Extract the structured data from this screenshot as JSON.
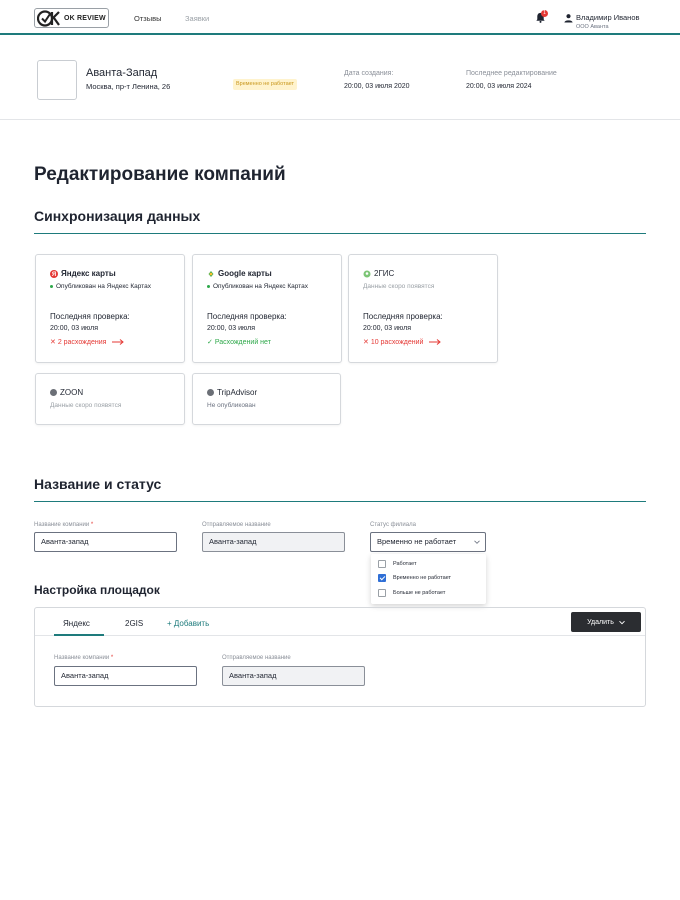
{
  "header": {
    "logo_text": "OK REVIEW",
    "nav": [
      {
        "label": "Отзывы"
      },
      {
        "label": "Заявки"
      }
    ],
    "notification_count": "1",
    "user": {
      "name": "Владимир Иванов",
      "org": "ООО Аванта"
    }
  },
  "company": {
    "name": "Аванта-Запад",
    "address": "Москва, пр-т Ленина, 26",
    "status": "Временно не работает",
    "created_label": "Дата создания:",
    "created_value": "20:00, 03 июля 2020",
    "edited_label": "Последнее редактирование",
    "edited_value": "20:00, 03 июля 2024"
  },
  "page_title": "Редактирование компаний",
  "sync": {
    "title": "Синхронизация данных",
    "cards": [
      {
        "name": "Яндекс карты",
        "icon": "yandex-icon",
        "color": "#e53935",
        "status": "Опубликован на Яндекс Картах",
        "check_label": "Последняя проверка:",
        "check_date": "20:00, 03 июля",
        "diff": "2 расхождения",
        "diff_type": "bad"
      },
      {
        "name": "Google карты",
        "icon": "google-icon",
        "color": "#4caf50",
        "status": "Опубликован на Яндекс Картах",
        "check_label": "Последняя проверка:",
        "check_date": "20:00, 03 июля",
        "diff": "Расхождений нет",
        "diff_type": "good"
      },
      {
        "name": "2ГИС",
        "icon": "2gis-icon",
        "color": "#7cc576",
        "status": "Данные скоро появятся",
        "check_label": "Последняя проверка:",
        "check_date": "20:00, 03 июля",
        "diff": "10 расхождений",
        "diff_type": "bad"
      },
      {
        "name": "ZOON",
        "icon": "zoon-icon",
        "color": "#6b6f76",
        "status": "Данные скоро появятся"
      },
      {
        "name": "TripAdvisor",
        "icon": "tripadvisor-icon",
        "color": "#6b6f76",
        "status": "Не опубликован"
      }
    ]
  },
  "name_status": {
    "title": "Название и статус",
    "company_name_label": "Название компании",
    "required_mark": "*",
    "company_name_value": "Аванта-запад",
    "display_name_label": "Отправляемое название",
    "display_name_value": "Аванта-запад",
    "branch_status_label": "Статус филиала",
    "branch_status_value": "Временно не работает",
    "options": [
      {
        "label": "Работает",
        "checked": false
      },
      {
        "label": "Временно не работает",
        "checked": true
      },
      {
        "label": "Больше не работает",
        "checked": false
      }
    ]
  },
  "platforms": {
    "title": "Настройка площадок",
    "tabs": [
      {
        "label": "Яндекс"
      },
      {
        "label": "2GIS"
      }
    ],
    "add_label": "+ Добавить",
    "delete_label": "Удалить",
    "company_name_label": "Название компании",
    "company_name_value": "Аванта-запад",
    "display_name_label": "Отправляемое название",
    "display_name_value": "Аванта-запад"
  },
  "colors": {
    "accent": "#1e7b7c",
    "error": "#e53935",
    "success": "#2ea84a",
    "warning_bg": "#fff3cd"
  }
}
